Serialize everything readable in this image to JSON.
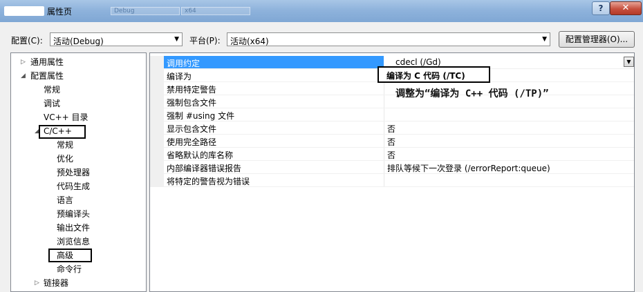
{
  "window": {
    "title": "属性页",
    "ghost_tabs": [
      "Debug",
      "x64"
    ]
  },
  "toolbar": {
    "config_label": "配置(C):",
    "config_value": "活动(Debug)",
    "platform_label": "平台(P):",
    "platform_value": "活动(x64)",
    "manager_button": "配置管理器(O)..."
  },
  "tree": {
    "general": "通用属性",
    "config_props": "配置属性",
    "cp_children": [
      "常规",
      "调试",
      "VC++ 目录"
    ],
    "cpp": "C/C++",
    "cpp_children": [
      "常规",
      "优化",
      "预处理器",
      "代码生成",
      "语言",
      "预编译头",
      "输出文件",
      "浏览信息",
      "高级",
      "命令行"
    ],
    "linker": "链接器"
  },
  "grid": {
    "rows": [
      {
        "name": "调用约定",
        "value": "__cdecl (/Gd)"
      },
      {
        "name": "编译为",
        "value": "编译为 C 代码 (/TC)"
      },
      {
        "name": "禁用特定警告",
        "value": ""
      },
      {
        "name": "强制包含文件",
        "value": ""
      },
      {
        "name": "强制 #using 文件",
        "value": ""
      },
      {
        "name": "显示包含文件",
        "value": "否"
      },
      {
        "name": "使用完全路径",
        "value": "否"
      },
      {
        "name": "省略默认的库名称",
        "value": "否"
      },
      {
        "name": "内部编译器错误报告",
        "value": "排队等候下一次登录 (/errorReport:queue)"
      },
      {
        "name": "将特定的警告视为错误",
        "value": ""
      }
    ]
  },
  "annotation": "调整为“编译为 C++ 代码 (/TP)”"
}
